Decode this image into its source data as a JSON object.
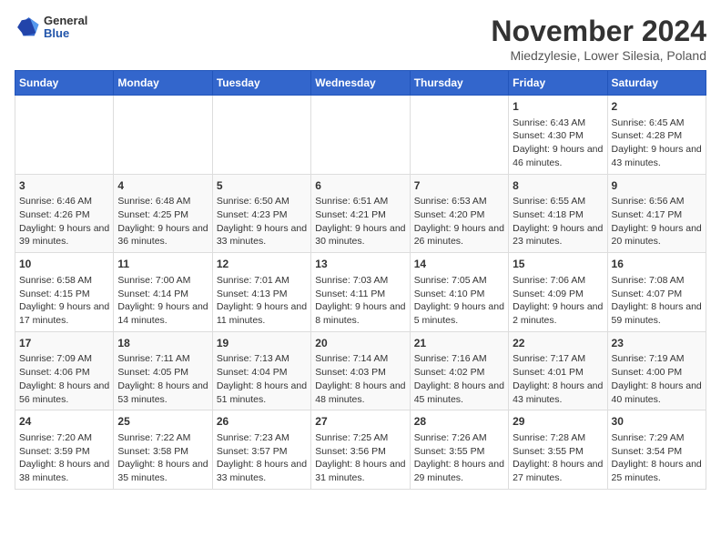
{
  "header": {
    "logo_general": "General",
    "logo_blue": "Blue",
    "month_title": "November 2024",
    "location": "Miedzylesie, Lower Silesia, Poland"
  },
  "days_of_week": [
    "Sunday",
    "Monday",
    "Tuesday",
    "Wednesday",
    "Thursday",
    "Friday",
    "Saturday"
  ],
  "weeks": [
    [
      {
        "day": "",
        "info": ""
      },
      {
        "day": "",
        "info": ""
      },
      {
        "day": "",
        "info": ""
      },
      {
        "day": "",
        "info": ""
      },
      {
        "day": "",
        "info": ""
      },
      {
        "day": "1",
        "info": "Sunrise: 6:43 AM\nSunset: 4:30 PM\nDaylight: 9 hours and 46 minutes."
      },
      {
        "day": "2",
        "info": "Sunrise: 6:45 AM\nSunset: 4:28 PM\nDaylight: 9 hours and 43 minutes."
      }
    ],
    [
      {
        "day": "3",
        "info": "Sunrise: 6:46 AM\nSunset: 4:26 PM\nDaylight: 9 hours and 39 minutes."
      },
      {
        "day": "4",
        "info": "Sunrise: 6:48 AM\nSunset: 4:25 PM\nDaylight: 9 hours and 36 minutes."
      },
      {
        "day": "5",
        "info": "Sunrise: 6:50 AM\nSunset: 4:23 PM\nDaylight: 9 hours and 33 minutes."
      },
      {
        "day": "6",
        "info": "Sunrise: 6:51 AM\nSunset: 4:21 PM\nDaylight: 9 hours and 30 minutes."
      },
      {
        "day": "7",
        "info": "Sunrise: 6:53 AM\nSunset: 4:20 PM\nDaylight: 9 hours and 26 minutes."
      },
      {
        "day": "8",
        "info": "Sunrise: 6:55 AM\nSunset: 4:18 PM\nDaylight: 9 hours and 23 minutes."
      },
      {
        "day": "9",
        "info": "Sunrise: 6:56 AM\nSunset: 4:17 PM\nDaylight: 9 hours and 20 minutes."
      }
    ],
    [
      {
        "day": "10",
        "info": "Sunrise: 6:58 AM\nSunset: 4:15 PM\nDaylight: 9 hours and 17 minutes."
      },
      {
        "day": "11",
        "info": "Sunrise: 7:00 AM\nSunset: 4:14 PM\nDaylight: 9 hours and 14 minutes."
      },
      {
        "day": "12",
        "info": "Sunrise: 7:01 AM\nSunset: 4:13 PM\nDaylight: 9 hours and 11 minutes."
      },
      {
        "day": "13",
        "info": "Sunrise: 7:03 AM\nSunset: 4:11 PM\nDaylight: 9 hours and 8 minutes."
      },
      {
        "day": "14",
        "info": "Sunrise: 7:05 AM\nSunset: 4:10 PM\nDaylight: 9 hours and 5 minutes."
      },
      {
        "day": "15",
        "info": "Sunrise: 7:06 AM\nSunset: 4:09 PM\nDaylight: 9 hours and 2 minutes."
      },
      {
        "day": "16",
        "info": "Sunrise: 7:08 AM\nSunset: 4:07 PM\nDaylight: 8 hours and 59 minutes."
      }
    ],
    [
      {
        "day": "17",
        "info": "Sunrise: 7:09 AM\nSunset: 4:06 PM\nDaylight: 8 hours and 56 minutes."
      },
      {
        "day": "18",
        "info": "Sunrise: 7:11 AM\nSunset: 4:05 PM\nDaylight: 8 hours and 53 minutes."
      },
      {
        "day": "19",
        "info": "Sunrise: 7:13 AM\nSunset: 4:04 PM\nDaylight: 8 hours and 51 minutes."
      },
      {
        "day": "20",
        "info": "Sunrise: 7:14 AM\nSunset: 4:03 PM\nDaylight: 8 hours and 48 minutes."
      },
      {
        "day": "21",
        "info": "Sunrise: 7:16 AM\nSunset: 4:02 PM\nDaylight: 8 hours and 45 minutes."
      },
      {
        "day": "22",
        "info": "Sunrise: 7:17 AM\nSunset: 4:01 PM\nDaylight: 8 hours and 43 minutes."
      },
      {
        "day": "23",
        "info": "Sunrise: 7:19 AM\nSunset: 4:00 PM\nDaylight: 8 hours and 40 minutes."
      }
    ],
    [
      {
        "day": "24",
        "info": "Sunrise: 7:20 AM\nSunset: 3:59 PM\nDaylight: 8 hours and 38 minutes."
      },
      {
        "day": "25",
        "info": "Sunrise: 7:22 AM\nSunset: 3:58 PM\nDaylight: 8 hours and 35 minutes."
      },
      {
        "day": "26",
        "info": "Sunrise: 7:23 AM\nSunset: 3:57 PM\nDaylight: 8 hours and 33 minutes."
      },
      {
        "day": "27",
        "info": "Sunrise: 7:25 AM\nSunset: 3:56 PM\nDaylight: 8 hours and 31 minutes."
      },
      {
        "day": "28",
        "info": "Sunrise: 7:26 AM\nSunset: 3:55 PM\nDaylight: 8 hours and 29 minutes."
      },
      {
        "day": "29",
        "info": "Sunrise: 7:28 AM\nSunset: 3:55 PM\nDaylight: 8 hours and 27 minutes."
      },
      {
        "day": "30",
        "info": "Sunrise: 7:29 AM\nSunset: 3:54 PM\nDaylight: 8 hours and 25 minutes."
      }
    ]
  ]
}
